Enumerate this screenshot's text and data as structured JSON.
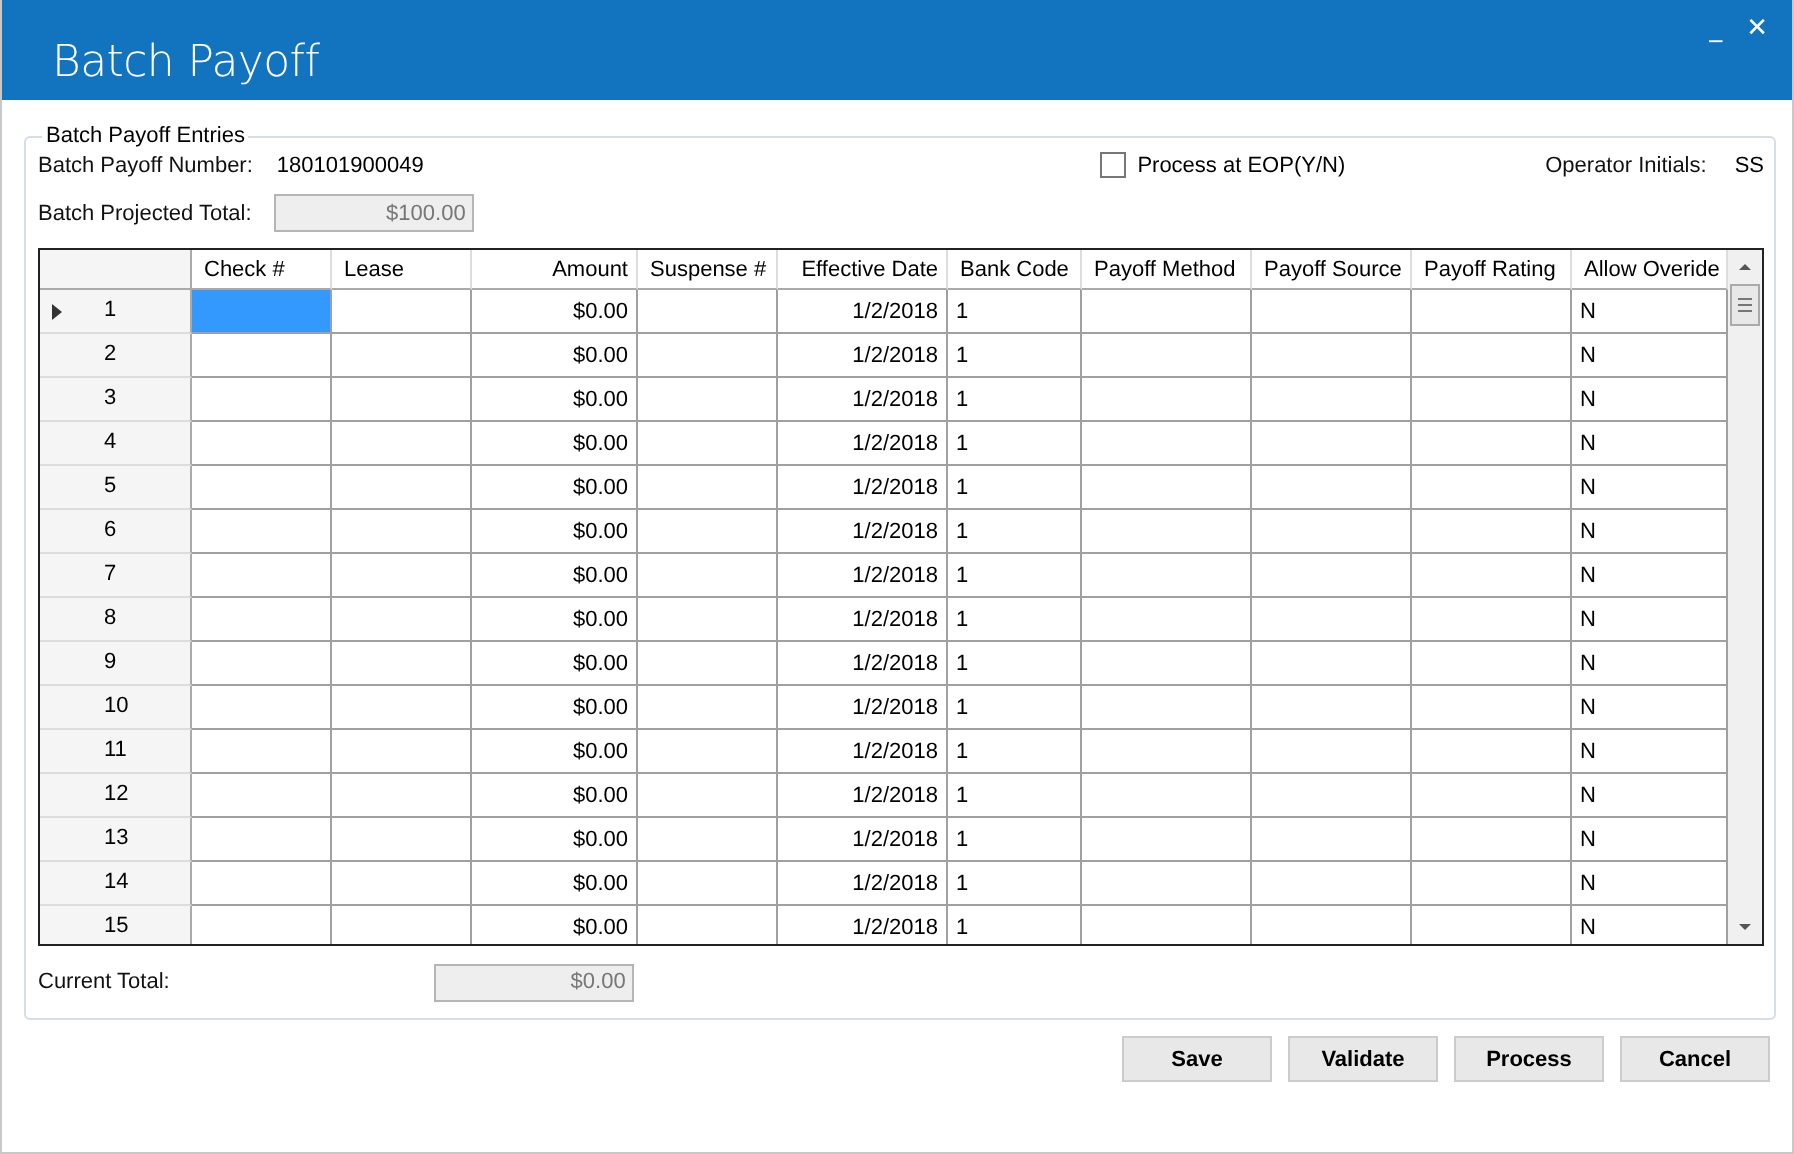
{
  "window": {
    "title": "Batch Payoff",
    "controls": [
      "_",
      "✕"
    ]
  },
  "group": {
    "title": "Batch Payoff Entries",
    "batch_number_label": "Batch Payoff Number:",
    "batch_number": "180101900049",
    "process_eop": {
      "label": "Process at EOP(Y/N)",
      "checked": false
    },
    "operator_label": "Operator Initials:",
    "operator": "SS",
    "projected_label": "Batch Projected Total:",
    "projected_total": "$100.00",
    "current_label": "Current Total:",
    "current_total": "$0.00"
  },
  "table": {
    "columns": [
      "Check #",
      "Lease",
      "Amount",
      "Suspense #",
      "Effective Date",
      "Bank Code",
      "Payoff Method",
      "Payoff Source",
      "Payoff Rating",
      "Allow Overide"
    ],
    "rows": [
      {
        "number": "1",
        "selected": true,
        "cells": [
          null,
          null,
          "$0.00",
          null,
          "1/2/2018",
          "1",
          null,
          null,
          null,
          "N"
        ]
      },
      {
        "number": "2",
        "selected": false,
        "cells": [
          null,
          null,
          "$0.00",
          null,
          "1/2/2018",
          "1",
          null,
          null,
          null,
          "N"
        ]
      },
      {
        "number": "3",
        "selected": false,
        "cells": [
          null,
          null,
          "$0.00",
          null,
          "1/2/2018",
          "1",
          null,
          null,
          null,
          "N"
        ]
      },
      {
        "number": "4",
        "selected": false,
        "cells": [
          null,
          null,
          "$0.00",
          null,
          "1/2/2018",
          "1",
          null,
          null,
          null,
          "N"
        ]
      },
      {
        "number": "5",
        "selected": false,
        "cells": [
          null,
          null,
          "$0.00",
          null,
          "1/2/2018",
          "1",
          null,
          null,
          null,
          "N"
        ]
      },
      {
        "number": "6",
        "selected": false,
        "cells": [
          null,
          null,
          "$0.00",
          null,
          "1/2/2018",
          "1",
          null,
          null,
          null,
          "N"
        ]
      },
      {
        "number": "7",
        "selected": false,
        "cells": [
          null,
          null,
          "$0.00",
          null,
          "1/2/2018",
          "1",
          null,
          null,
          null,
          "N"
        ]
      },
      {
        "number": "8",
        "selected": false,
        "cells": [
          null,
          null,
          "$0.00",
          null,
          "1/2/2018",
          "1",
          null,
          null,
          null,
          "N"
        ]
      },
      {
        "number": "9",
        "selected": false,
        "cells": [
          null,
          null,
          "$0.00",
          null,
          "1/2/2018",
          "1",
          null,
          null,
          null,
          "N"
        ]
      },
      {
        "number": "10",
        "selected": false,
        "cells": [
          null,
          null,
          "$0.00",
          null,
          "1/2/2018",
          "1",
          null,
          null,
          null,
          "N"
        ]
      },
      {
        "number": "11",
        "selected": false,
        "cells": [
          null,
          null,
          "$0.00",
          null,
          "1/2/2018",
          "1",
          null,
          null,
          null,
          "N"
        ]
      },
      {
        "number": "12",
        "selected": false,
        "cells": [
          null,
          null,
          "$0.00",
          null,
          "1/2/2018",
          "1",
          null,
          null,
          null,
          "N"
        ]
      },
      {
        "number": "13",
        "selected": false,
        "cells": [
          null,
          null,
          "$0.00",
          null,
          "1/2/2018",
          "1",
          null,
          null,
          null,
          "N"
        ]
      },
      {
        "number": "14",
        "selected": false,
        "cells": [
          null,
          null,
          "$0.00",
          null,
          "1/2/2018",
          "1",
          null,
          null,
          null,
          "N"
        ]
      },
      {
        "number": "15",
        "selected": false,
        "cells": [
          null,
          null,
          "$0.00",
          null,
          "1/2/2018",
          "1",
          null,
          null,
          null,
          "N"
        ]
      }
    ]
  },
  "buttons": [
    "Save",
    "Validate",
    "Process",
    "Cancel"
  ]
}
